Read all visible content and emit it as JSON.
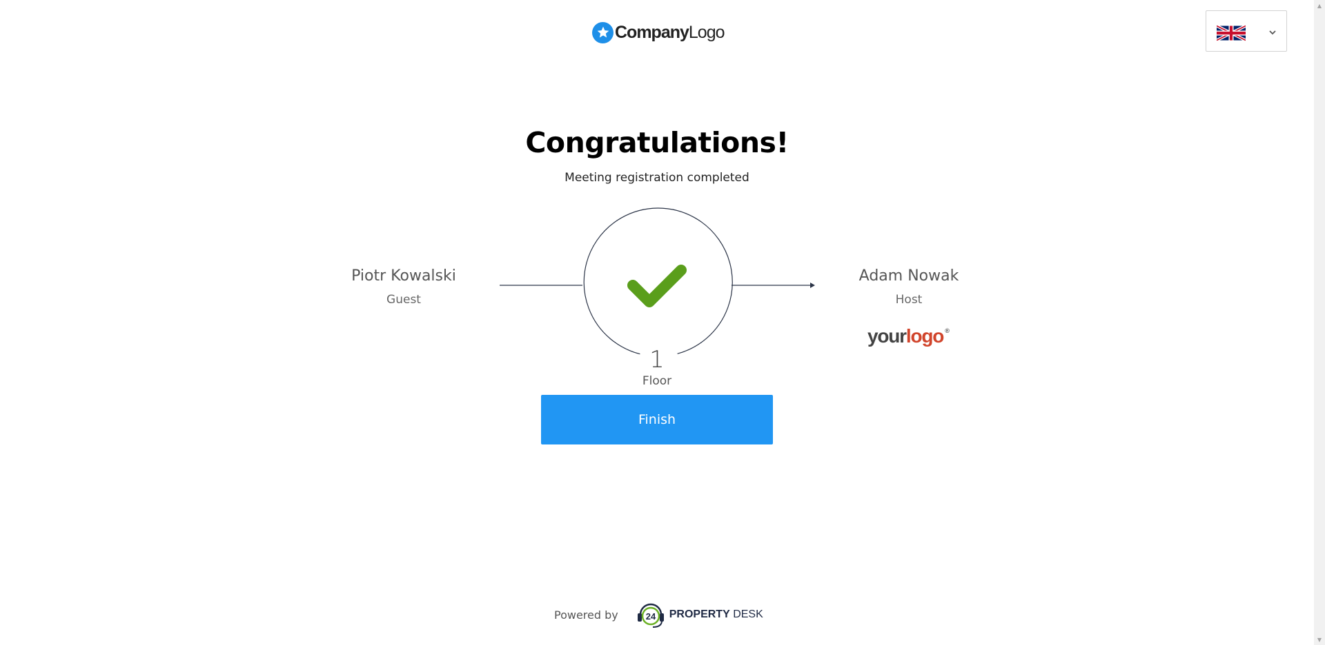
{
  "header": {
    "logo_text_bold": "Company",
    "logo_text_regular": "Logo",
    "language": {
      "selected": "English (UK)",
      "flag": "uk-flag-icon"
    }
  },
  "main": {
    "title": "Congratulations!",
    "subtitle": "Meeting registration completed",
    "guest": {
      "name": "Piotr Kowalski",
      "role": "Guest"
    },
    "host": {
      "name": "Adam Nowak",
      "role": "Host"
    },
    "host_logo": {
      "your": "your",
      "logo": "logo",
      "mark": "®"
    },
    "floor": {
      "number": "1",
      "label": "Floor"
    },
    "finish_label": "Finish",
    "status_icon": "checkmark-icon"
  },
  "footer": {
    "powered_by": "Powered by",
    "brand_bold": "PROPERTY",
    "brand_regular": " DESK",
    "badge_number": "24"
  },
  "colors": {
    "accent": "#2196f3",
    "check": "#5a9e1b",
    "brand_logo": "#1e8fe8",
    "your_logo_red": "#d1452c"
  }
}
